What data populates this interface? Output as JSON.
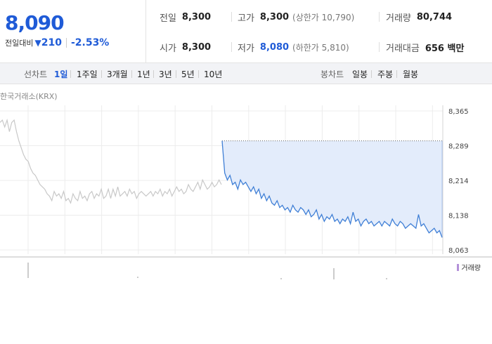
{
  "quote": {
    "price": "8,090",
    "change_label": "전일대비",
    "change_value": "210",
    "change_rate": "-2.53%",
    "prev_close_label": "전일",
    "prev_close": "8,300",
    "high_label": "고가",
    "high": "8,300",
    "upper_limit": "(상한가 10,790)",
    "volume_label": "거래량",
    "volume": "80,744",
    "open_label": "시가",
    "open": "8,300",
    "low_label": "저가",
    "low": "8,080",
    "lower_limit": "(하한가 5,810)",
    "amount_label": "거래대금",
    "amount": "656 백만",
    "down_color": "#1f5bd7"
  },
  "toolbar": {
    "line_label": "선차트",
    "line_periods": [
      "1일",
      "1주일",
      "3개월",
      "1년",
      "3년",
      "5년",
      "10년"
    ],
    "active_period": "1일",
    "candle_label": "봉차트",
    "candle_periods": [
      "일봉",
      "주봉",
      "월봉"
    ]
  },
  "market_label": "한국거래소(KRX)",
  "volume_legend": "거래량",
  "chart_data": {
    "type": "line",
    "y_ticks": [
      "8,365",
      "8,289",
      "8,214",
      "8,138",
      "8,063"
    ],
    "ylim": [
      8063,
      8365
    ],
    "reference_line": 8300,
    "series": [
      {
        "values": [
          8340,
          8345,
          8330,
          8345,
          8320,
          8340,
          8345,
          8320,
          8300,
          8285,
          8270,
          8260,
          8255,
          8240,
          8230,
          8225,
          8215,
          8205,
          8200,
          8195,
          8185,
          8180,
          8170,
          8190,
          8180,
          8185,
          8175,
          8190,
          8170,
          8175,
          8165,
          8185,
          8175,
          8170,
          8190,
          8175,
          8180,
          8170,
          8185,
          8190,
          8175,
          8185,
          8180,
          8195,
          8175,
          8180,
          8195,
          8175,
          8195,
          8180,
          8200,
          8180,
          8185,
          8190,
          8180,
          8195,
          8185,
          8190,
          8175,
          8185,
          8190,
          8185,
          8180,
          8185,
          8190,
          8180,
          8190,
          8185,
          8195,
          8180,
          8190,
          8185,
          8195,
          8180,
          8190,
          8200,
          8190,
          8195,
          8185,
          8190,
          8205,
          8195,
          8190,
          8200,
          8210,
          8195,
          8215,
          8205,
          8195,
          8200,
          8210,
          8200,
          8205,
          8215,
          8205
        ],
        "color": "#c8c8c8"
      },
      {
        "values": [
          8300,
          8230,
          8215,
          8225,
          8205,
          8210,
          8195,
          8215,
          8205,
          8210,
          8200,
          8190,
          8200,
          8185,
          8195,
          8175,
          8185,
          8170,
          8180,
          8165,
          8160,
          8170,
          8155,
          8160,
          8150,
          8155,
          8145,
          8160,
          8150,
          8145,
          8155,
          8150,
          8140,
          8150,
          8135,
          8140,
          8150,
          8130,
          8140,
          8125,
          8135,
          8130,
          8140,
          8125,
          8130,
          8120,
          8130,
          8125,
          8135,
          8120,
          8145,
          8125,
          8130,
          8115,
          8125,
          8130,
          8120,
          8125,
          8115,
          8120,
          8125,
          8115,
          8125,
          8120,
          8115,
          8130,
          8120,
          8115,
          8125,
          8120,
          8110,
          8115,
          8120,
          8115,
          8110,
          8140,
          8115,
          8120,
          8110,
          8100,
          8105,
          8110,
          8100,
          8105,
          8090
        ],
        "color": "#3f7fd6",
        "fill": "#e3ecfb"
      }
    ]
  }
}
